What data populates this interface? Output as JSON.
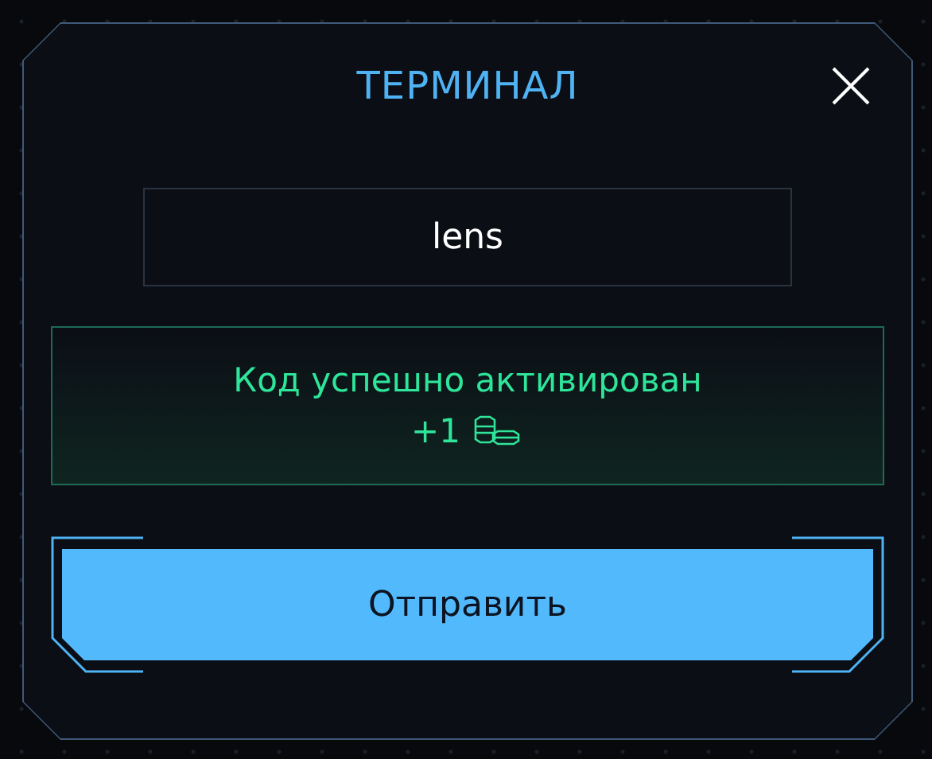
{
  "dialog": {
    "title": "ТЕРМИНАЛ"
  },
  "code_field": {
    "value": "lens"
  },
  "result": {
    "success": true,
    "message": "Код успешно активирован",
    "reward": "+1"
  },
  "submit_button": {
    "label": "Отправить"
  }
}
